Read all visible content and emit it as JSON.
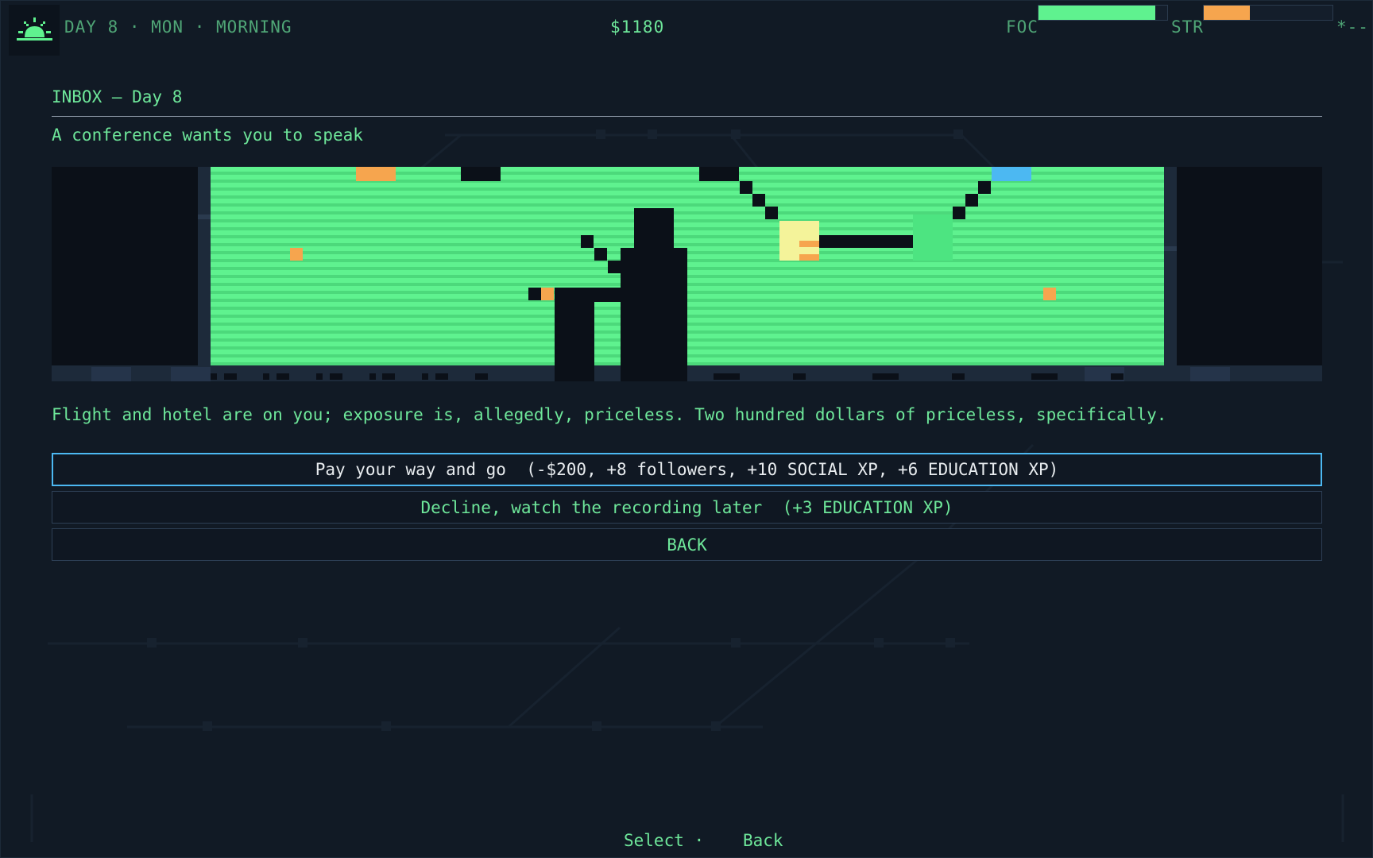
{
  "hud": {
    "day": "DAY 8 · MON · MORNING",
    "money": "$1180",
    "focus_label": "FOC",
    "strength_label": "STR",
    "corner": "*--",
    "focus_level": 0.91,
    "strength_level": 0.36,
    "focus_color": "#5ff28f",
    "strength_color": "#f6a54e",
    "icon": "sunrise-icon"
  },
  "inbox": {
    "title": "INBOX — Day 8",
    "subject": "A conference wants you to speak",
    "scene_icon": "conference-stage-illustration",
    "body": "Flight and hotel are on you; exposure is, allegedly, priceless. Two hundred dollars of priceless, specifically."
  },
  "choices": [
    {
      "label": "Pay your way and go  (-$200, +8 followers, +10 SOCIAL XP, +6 EDUCATION XP)",
      "selected": true
    },
    {
      "label": "Decline, watch the recording later  (+3 EDUCATION XP)",
      "selected": false
    },
    {
      "label": "BACK",
      "selected": false
    }
  ],
  "footer": {
    "select": "Select ·",
    "back": "Back"
  },
  "colors": {
    "background": "#111a25",
    "text": "#6ee79a",
    "screen_green": "#5ff28f",
    "accent_orange": "#f6a54e",
    "accent_blue": "#4cb8f2",
    "silhouette": "#0b1018"
  }
}
